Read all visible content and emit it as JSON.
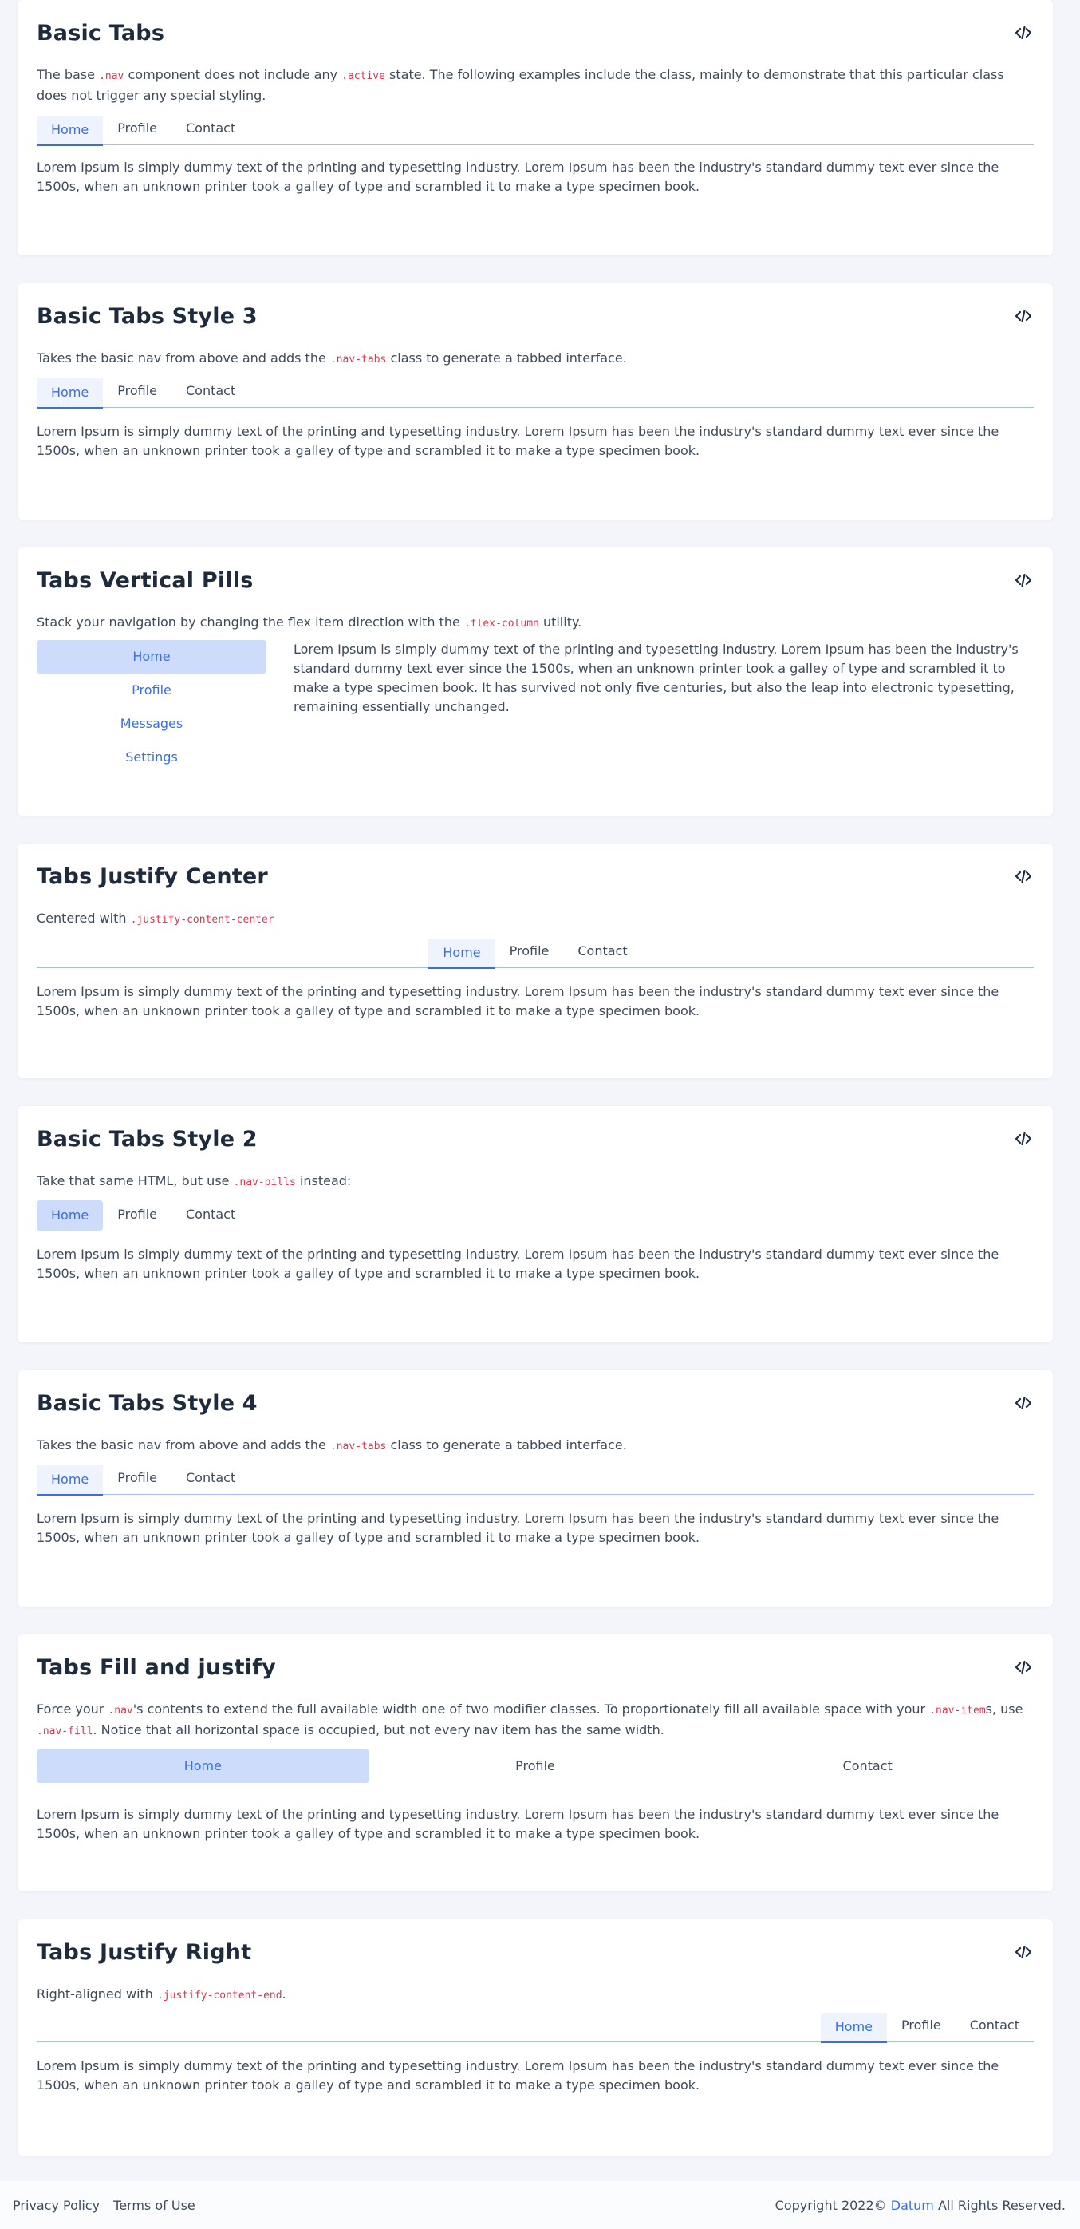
{
  "icons": {
    "code": "code-icon"
  },
  "colors": {
    "accent": "#3c6fde",
    "pill_bg": "#cddcfb",
    "code": "#e0344e",
    "page_bg": "#f3f5fb"
  },
  "lorem_short": "Lorem Ipsum is simply dummy text of the printing and typesetting industry. Lorem Ipsum has been the industry's standard dummy text ever since the 1500s, when an unknown printer took a galley of type and scrambled it to make a type specimen book.",
  "tabs3": [
    "Home",
    "Profile",
    "Contact"
  ],
  "basic_tabs": {
    "title": "Basic Tabs",
    "desc_1": "The base ",
    "code_1": ".nav",
    "desc_2": " component does not include any ",
    "code_2": ".active",
    "desc_3": " state. The following examples include the class, mainly to demonstrate that this particular class does not trigger any special styling."
  },
  "style3": {
    "title": "Basic Tabs Style 3",
    "desc_1": "Takes the basic nav from above and adds the ",
    "code_1": ".nav-tabs",
    "desc_2": " class to generate a tabbed interface."
  },
  "vertical": {
    "title": "Tabs Vertical Pills",
    "desc_1": "Stack your navigation by changing the flex item direction with the ",
    "code_1": ".flex-column",
    "desc_2": " utility.",
    "items": [
      "Home",
      "Profile",
      "Messages",
      "Settings"
    ],
    "text": "Lorem Ipsum is simply dummy text of the printing and typesetting industry. Lorem Ipsum has been the industry's standard dummy text ever since the 1500s, when an unknown printer took a galley of type and scrambled it to make a type specimen book. It has survived not only five centuries, but also the leap into electronic typesetting, remaining essentially unchanged."
  },
  "center": {
    "title": "Tabs Justify Center",
    "desc_1": "Centered with ",
    "code_1": ".justify-content-center"
  },
  "style2": {
    "title": "Basic Tabs Style 2",
    "desc_1": "Take that same HTML, but use ",
    "code_1": ".nav-pills",
    "desc_2": " instead:"
  },
  "style4": {
    "title": "Basic Tabs Style 4",
    "desc_1": "Takes the basic nav from above and adds the ",
    "code_1": ".nav-tabs",
    "desc_2": " class to generate a tabbed interface."
  },
  "fill": {
    "title": "Tabs Fill and justify",
    "desc_1": "Force your ",
    "code_1": ".nav",
    "desc_2": "'s contents to extend the full available width one of two modifier classes. To proportionately fill all available space with your ",
    "code_2": ".nav-item",
    "desc_3": "s, use ",
    "code_3": ".nav-fill",
    "desc_4": ". Notice that all horizontal space is occupied, but not every nav item has the same width."
  },
  "right": {
    "title": "Tabs Justify Right",
    "desc_1": "Right-aligned with ",
    "code_1": ".justify-content-end",
    "desc_2": "."
  },
  "footer": {
    "privacy": "Privacy Policy",
    "terms": "Terms of Use",
    "copy_1": "Copyright 2022© ",
    "brand": "Datum",
    "copy_2": " All Rights Reserved."
  }
}
